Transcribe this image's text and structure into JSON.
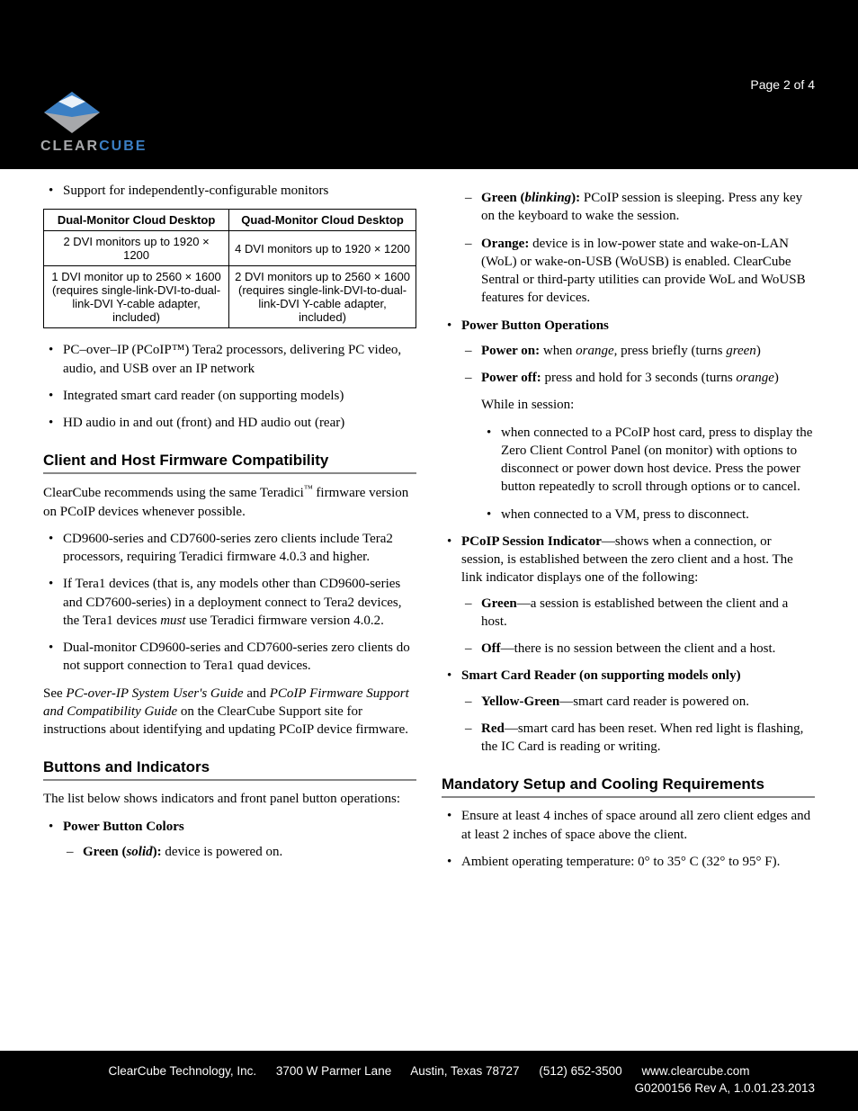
{
  "header": {
    "page_number": "Page 2 of 4",
    "logo_clear": "CLEAR",
    "logo_cube": "CUBE"
  },
  "left": {
    "intro_bullet": "Support for independently-configurable monitors",
    "table": {
      "head_dual": "Dual-Monitor Cloud Desktop",
      "head_quad": "Quad-Monitor Cloud Desktop",
      "r1c1": "2 DVI monitors up to 1920 × 1200",
      "r1c2": "4 DVI monitors up to 1920 × 1200",
      "r2c1": "1 DVI monitor up to 2560 × 1600 (requires single-link-DVI-to-dual-link-DVI Y-cable adapter, included)",
      "r2c2": "2 DVI monitors up to 2560 × 1600 (requires single-link-DVI-to-dual-link-DVI Y-cable adapter, included)"
    },
    "bullets_b1": "PC–over–IP (PCoIP™) Tera2 processors, delivering PC video, audio, and USB over an IP network",
    "bullets_b2": "Integrated smart card reader (on supporting models)",
    "bullets_b3": "HD audio in and out (front) and HD audio out (rear)",
    "compat_heading": "Client and Host Firmware Compatibility",
    "compat_p_pre": "ClearCube recommends using the same Teradici",
    "compat_p_tm": "™",
    "compat_p_post": " firmware version on PCoIP devices whenever possible.",
    "compat_b1": "CD9600-series and CD7600-series zero clients include Tera2 processors, requiring Teradici firmware 4.0.3 and higher.",
    "compat_b2_pre": "If Tera1 devices (that is, any models other than CD9600-series and CD7600-series) in a deployment connect to Tera2 devices, the Tera1 devices ",
    "compat_b2_em": "must",
    "compat_b2_post": " use Teradici firmware version 4.0.2.",
    "compat_b3": "Dual-monitor CD9600-series and CD7600-series zero clients do not support connection to Tera1 quad devices.",
    "compat_see_pre": "See ",
    "compat_see_g1": "PC-over-IP System User's Guide",
    "compat_see_mid": " and ",
    "compat_see_g2": "PCoIP Firmware Support and Compatibility Guide",
    "compat_see_post": " on the ClearCube Support site for instructions about identifying and updating PCoIP device firmware.",
    "buttons_heading": "Buttons and Indicators",
    "buttons_intro": "The list below shows indicators and front panel button operations:",
    "pbc_label": "Power Button Colors",
    "pbc_green_l": "Green (",
    "pbc_green_s": "solid",
    "pbc_green_r": "):",
    "pbc_green_t": " device is powered on."
  },
  "right": {
    "pbc_greenb_l": "Green (",
    "pbc_greenb_s": "blinking",
    "pbc_greenb_r": "):",
    "pbc_greenb_t": " PCoIP session is sleeping. Press any key on the keyboard to wake the session.",
    "pbc_orange_l": "Orange:",
    "pbc_orange_t": " device is in low-power state and wake-on-LAN (WoL) or wake-on-USB (WoUSB) is enabled. ClearCube Sentral or third-party utilities can provide WoL and WoUSB features for devices.",
    "pbo_label": "Power Button Operations",
    "pbo_on_l": "Power on:",
    "pbo_on_pre": " when ",
    "pbo_on_em": "orange",
    "pbo_on_mid": ", press briefly (turns ",
    "pbo_on_em2": "green",
    "pbo_on_post": ")",
    "pbo_off_l": "Power off:",
    "pbo_off_pre": " press and hold for 3 seconds (turns ",
    "pbo_off_em": "orange",
    "pbo_off_post": ")",
    "pbo_while": "While in session:",
    "pbo_s1": "when connected to a PCoIP host card, press to display the Zero Client Control Panel (on monitor) with options to disconnect or power down host device. Press the power button repeatedly to scroll through options or to cancel.",
    "pbo_s2": "when connected to a VM, press to disconnect.",
    "psi_l": "PCoIP Session Indicator",
    "psi_t": "—shows when a connection, or session, is established between the zero client and a host. The link indicator displays one of the following:",
    "psi_green_l": "Green",
    "psi_green_t": "—a session is established between the client and a host.",
    "psi_off_l": "Off",
    "psi_off_t": "—there is no session between the client and a host.",
    "scr_label": "Smart Card Reader (on supporting models only)",
    "scr_yg_l": "Yellow-Green",
    "scr_yg_t": "—smart card reader is powered on.",
    "scr_red_l": "Red",
    "scr_red_t": "—smart card has been reset. When red light is flashing, the IC Card is reading or writing.",
    "setup_heading": "Mandatory Setup and Cooling Requirements",
    "setup_b1": "Ensure at least 4 inches of space around all zero client edges and at least 2 inches of space above the client.",
    "setup_b2": "Ambient operating temperature: 0° to 35° C (32° to 95° F)."
  },
  "footer": {
    "company": "ClearCube Technology, Inc.",
    "addr1": "3700 W Parmer Lane",
    "addr2": "Austin, Texas 78727",
    "phone": "(512) 652-3500",
    "url": "www.clearcube.com",
    "doc": "G0200156 Rev A, 1.0.01.23.2013"
  }
}
